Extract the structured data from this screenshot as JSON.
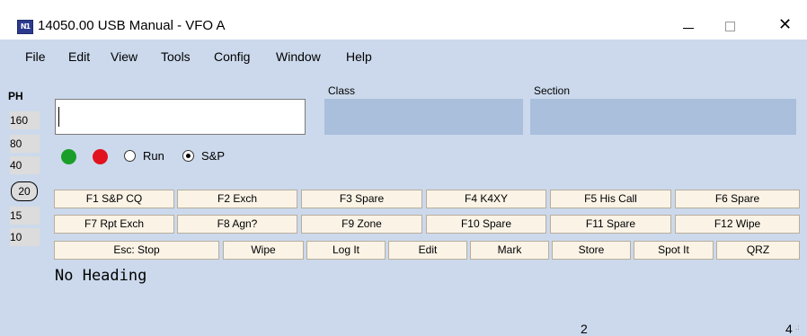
{
  "window": {
    "title": "14050.00 USB Manual - VFO A",
    "icon": "n1mm-logo-icon",
    "controls": {
      "minimize": "minimize-icon",
      "maximize": "maximize-icon",
      "close": "close-icon"
    }
  },
  "menu": {
    "file": "File",
    "edit": "Edit",
    "view": "View",
    "tools": "Tools",
    "config": "Config",
    "window": "Window",
    "help": "Help"
  },
  "bands": {
    "mode": "PH",
    "b160": "160",
    "b80": "80",
    "b40": "40",
    "b20": "20",
    "b15": "15",
    "b10": "10",
    "selected": "20"
  },
  "entry": {
    "class_label": "Class",
    "section_label": "Section",
    "callsign_value": "",
    "class_value": "",
    "section_value": ""
  },
  "status_lights": {
    "green": "#1a9e2a",
    "red": "#e1121e"
  },
  "mode_radio": {
    "run_label": "Run",
    "sp_label": "S&P",
    "selected": "S&P"
  },
  "function_keys": {
    "f1": "F1 S&P CQ",
    "f2": "F2 Exch",
    "f3": "F3 Spare",
    "f4": "F4 K4XY",
    "f5": "F5 His Call",
    "f6": "F6 Spare",
    "f7": "F7 Rpt Exch",
    "f8": "F8 Agn?",
    "f9": "F9 Zone",
    "f10": "F10 Spare",
    "f11": "F11 Spare",
    "f12": "F12 Wipe"
  },
  "actions": {
    "esc": "Esc: Stop",
    "wipe": "Wipe",
    "log": "Log It",
    "edit": "Edit",
    "mark": "Mark",
    "store": "Store",
    "spot": "Spot It",
    "qrz": "QRZ"
  },
  "info": {
    "heading": "No Heading",
    "status_2": "2",
    "status_4": "4"
  },
  "colors": {
    "background": "#ccd9ec",
    "field_fill": "#a9bfdc",
    "button_fill": "#faf3e6"
  }
}
